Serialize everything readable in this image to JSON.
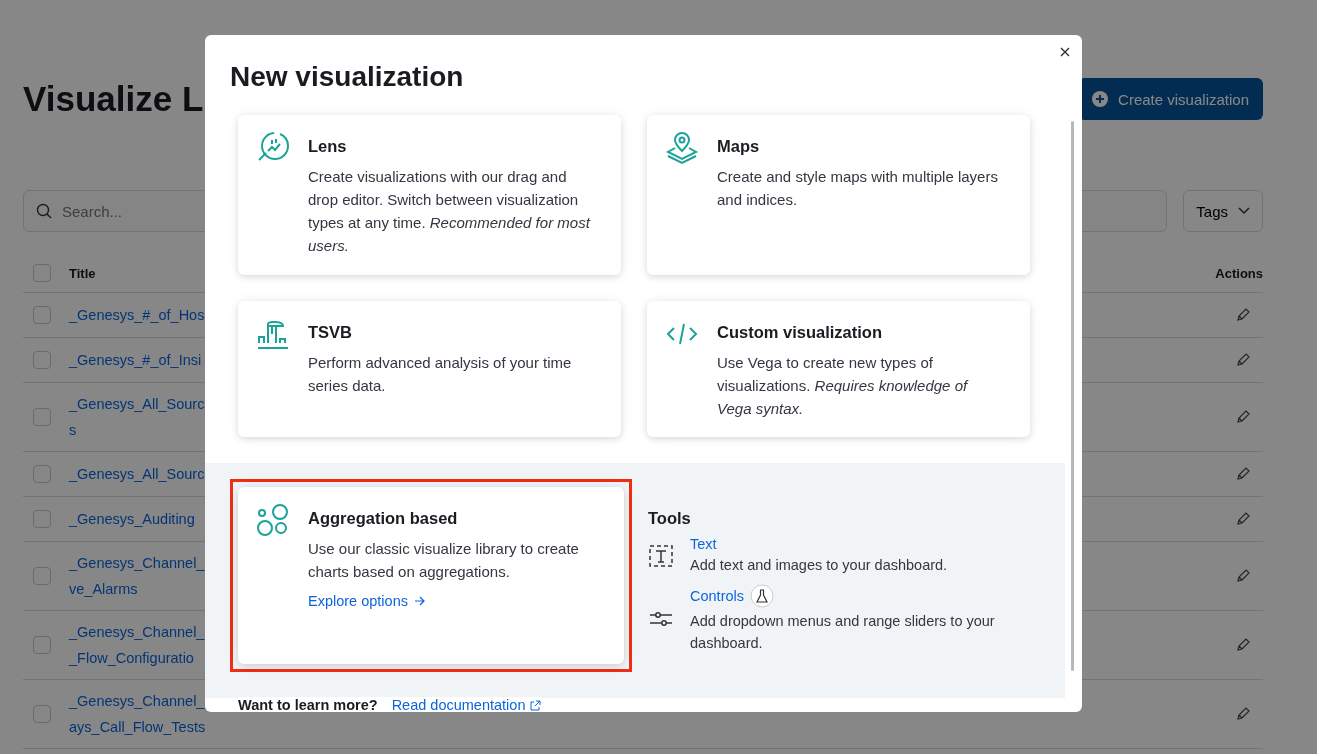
{
  "page": {
    "title": "Visualize L",
    "create_button": "Create visualization",
    "search_placeholder": "Search...",
    "tags_button": "Tags",
    "columns": {
      "title": "Title",
      "actions": "Actions"
    },
    "select_all_checked": false,
    "rows": [
      {
        "lines": [
          "_Genesys_#_of_Hos"
        ],
        "checked": false
      },
      {
        "lines": [
          "_Genesys_#_of_Insi"
        ],
        "checked": false
      },
      {
        "lines": [
          "_Genesys_All_Sourc",
          "s"
        ],
        "checked": false
      },
      {
        "lines": [
          "_Genesys_All_Sourc"
        ],
        "checked": false
      },
      {
        "lines": [
          "_Genesys_Auditing"
        ],
        "checked": false
      },
      {
        "lines": [
          "_Genesys_Channel_",
          "ve_Alarms"
        ],
        "checked": false
      },
      {
        "lines": [
          "_Genesys_Channel_",
          "_Flow_Configuratio"
        ],
        "checked": false
      },
      {
        "lines": [
          "_Genesys_Channel_",
          "ays_Call_Flow_Tests"
        ],
        "checked": false
      }
    ]
  },
  "modal": {
    "title": "New visualization",
    "cards": [
      {
        "kind": "lens",
        "title": "Lens",
        "description": "Create visualizations with our drag and drop editor. Switch between visualization types at any time. *Recommended for most users.*"
      },
      {
        "kind": "maps",
        "title": "Maps",
        "description": "Create and style maps with multiple layers and indices."
      },
      {
        "kind": "tsvb",
        "title": "TSVB",
        "description": "Perform advanced analysis of your time series data."
      },
      {
        "kind": "code",
        "title": "Custom visualization",
        "description": "Use Vega to create new types of visualizations. *Requires knowledge of Vega syntax.*"
      }
    ],
    "featured": {
      "title": "Aggregation based",
      "description": "Use our classic visualize library to create charts based on aggregations.",
      "link": "Explore options",
      "highlighted": true
    },
    "tools": {
      "heading": "Tools",
      "items": [
        {
          "kind": "text",
          "title": "Text",
          "description": "Add text and images to your dashboard.",
          "experimental": false
        },
        {
          "kind": "controls",
          "title": "Controls",
          "description": "Add dropdown menus and range sliders to your dashboard.",
          "experimental": true
        }
      ]
    },
    "footer": {
      "question": "Want to learn more?",
      "link": "Read documentation"
    }
  }
}
